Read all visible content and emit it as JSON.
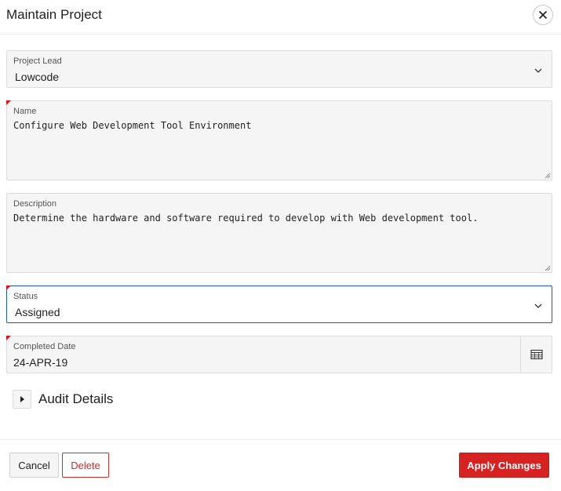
{
  "dialog": {
    "title": "Maintain Project",
    "close_icon": "close-icon"
  },
  "fields": {
    "project_lead": {
      "label": "Project Lead",
      "value": "Lowcode"
    },
    "name": {
      "label": "Name",
      "value": "Configure Web Development Tool Environment",
      "required": true
    },
    "description": {
      "label": "Description",
      "value": "Determine the hardware and software required to develop with Web development tool."
    },
    "status": {
      "label": "Status",
      "value": "Assigned",
      "required": true
    },
    "completed_date": {
      "label": "Completed Date",
      "value": "24-APR-19",
      "required": true,
      "icon": "calendar-icon"
    }
  },
  "audit": {
    "label": "Audit Details",
    "icon": "triangle-right-icon",
    "expanded": false
  },
  "buttons": {
    "cancel": "Cancel",
    "delete": "Delete",
    "apply": "Apply Changes"
  },
  "colors": {
    "accent_red": "#d62322",
    "required_marker": "#e0131c",
    "focus_border": "#1a5ea6"
  }
}
